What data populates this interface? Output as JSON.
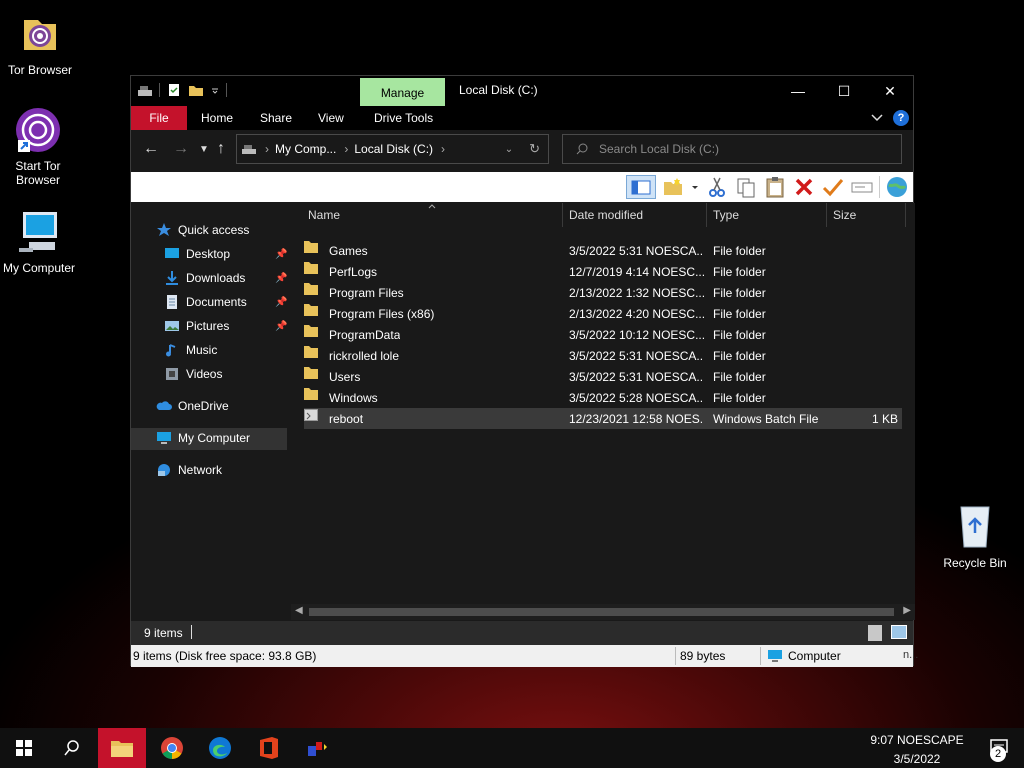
{
  "desktop": {
    "icons": [
      {
        "label": "Tor Browser"
      },
      {
        "label": "Start Tor Browser"
      },
      {
        "label": "My Computer"
      },
      {
        "label": "Recycle Bin"
      }
    ]
  },
  "window": {
    "title": "Local Disk (C:)",
    "contextual_tab": "Manage",
    "ribbon_tabs": [
      "File",
      "Home",
      "Share",
      "View",
      "Drive Tools"
    ],
    "address": {
      "crumbs": [
        "My Comp...",
        "Local Disk (C:)"
      ]
    },
    "search_placeholder": "Search Local Disk (C:)",
    "accent_file_tab": "#c4122b",
    "accent_manage": "#a7e6a0"
  },
  "sidebar": {
    "items": [
      {
        "label": "Quick access",
        "icon": "star-icon"
      },
      {
        "label": "Desktop",
        "icon": "desktop-icon",
        "pinned": true
      },
      {
        "label": "Downloads",
        "icon": "download-icon",
        "pinned": true
      },
      {
        "label": "Documents",
        "icon": "documents-icon",
        "pinned": true
      },
      {
        "label": "Pictures",
        "icon": "pictures-icon",
        "pinned": true
      },
      {
        "label": "Music",
        "icon": "music-icon"
      },
      {
        "label": "Videos",
        "icon": "videos-icon"
      },
      {
        "label": "OneDrive",
        "icon": "cloud-icon"
      },
      {
        "label": "My Computer",
        "icon": "computer-icon",
        "selected": true
      },
      {
        "label": "Network",
        "icon": "network-icon"
      }
    ]
  },
  "file_list": {
    "columns": [
      "Name",
      "Date modified",
      "Type",
      "Size"
    ],
    "rows": [
      {
        "name": "Games",
        "date": "3/5/2022 5:31 NOESCA...",
        "type": "File folder",
        "size": ""
      },
      {
        "name": "PerfLogs",
        "date": "12/7/2019 4:14 NOESC...",
        "type": "File folder",
        "size": ""
      },
      {
        "name": "Program Files",
        "date": "2/13/2022 1:32 NOESC...",
        "type": "File folder",
        "size": ""
      },
      {
        "name": "Program Files (x86)",
        "date": "2/13/2022 4:20 NOESC...",
        "type": "File folder",
        "size": ""
      },
      {
        "name": "ProgramData",
        "date": "3/5/2022 10:12 NOESC...",
        "type": "File folder",
        "size": ""
      },
      {
        "name": "rickrolled lole",
        "date": "3/5/2022 5:31 NOESCA...",
        "type": "File folder",
        "size": ""
      },
      {
        "name": "Users",
        "date": "3/5/2022 5:31 NOESCA...",
        "type": "File folder",
        "size": ""
      },
      {
        "name": "Windows",
        "date": "3/5/2022 5:28 NOESCA...",
        "type": "File folder",
        "size": ""
      },
      {
        "name": "reboot",
        "date": "12/23/2021 12:58 NOES...",
        "type": "Windows Batch File",
        "size": "1 KB",
        "selected": true
      }
    ]
  },
  "status": {
    "items_count": "9 items",
    "disk_info": "9 items (Disk free space: 93.8 GB)",
    "size": "89 bytes",
    "location": "Computer",
    "tail": "n..."
  },
  "taskbar": {
    "time": "9:07 NOESCAPE",
    "date": "3/5/2022",
    "notification_count": "2"
  }
}
